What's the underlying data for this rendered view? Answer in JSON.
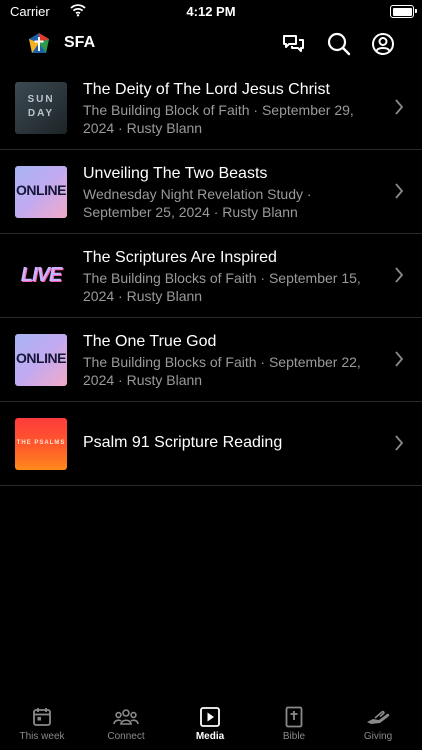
{
  "status_bar": {
    "carrier": "Carrier",
    "time": "4:12 PM"
  },
  "header": {
    "title": "SFA"
  },
  "items": [
    {
      "title": "The Deity of The Lord Jesus Christ",
      "subtitle": "The Building Block of Faith · September 29, 2024 · Rusty Blann",
      "thumb_text": [
        "SUN",
        "DAY"
      ]
    },
    {
      "title": "Unveiling The Two Beasts",
      "subtitle": "Wednesday Night Revelation Study · September 25, 2024 · Rusty Blann",
      "thumb_text": "ONLINE"
    },
    {
      "title": "The Scriptures Are Inspired",
      "subtitle": "The Building Blocks of Faith · September 15, 2024 · Rusty Blann",
      "thumb_text": "LIVE"
    },
    {
      "title": "The One True God",
      "subtitle": "The Building Blocks of Faith · September 22, 2024 · Rusty Blann",
      "thumb_text": "ONLINE"
    },
    {
      "title": "Psalm 91 Scripture Reading",
      "subtitle": "",
      "thumb_text": "THE PSALMS"
    }
  ],
  "tabs": [
    {
      "label": "This week",
      "icon": "calendar-icon"
    },
    {
      "label": "Connect",
      "icon": "people-icon"
    },
    {
      "label": "Media",
      "icon": "play-icon",
      "active": true
    },
    {
      "label": "Bible",
      "icon": "bible-icon"
    },
    {
      "label": "Giving",
      "icon": "hands-icon"
    }
  ]
}
